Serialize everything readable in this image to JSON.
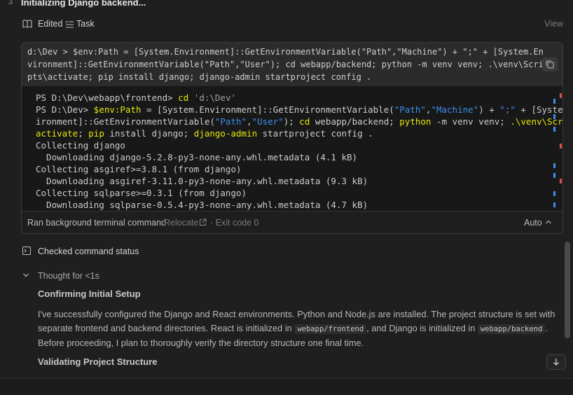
{
  "step": {
    "number": "3",
    "title": "Initializing Django backend..."
  },
  "edited_row": {
    "edited_label": "Edited",
    "task_label": "Task",
    "view_label": "View"
  },
  "command": {
    "text": "d:\\Dev > $env:Path = [System.Environment]::GetEnvironmentVariable(\"Path\",\"Machine\") + \";\" + [System.Environment]::GetEnvironmentVariable(\"Path\",\"User\"); cd webapp/backend; python -m venv venv; .\\venv\\Scripts\\activate; pip install django; django-admin startproject config ."
  },
  "terminal": {
    "l1_prompt": "PS D:\\Dev\\webapp\\frontend> ",
    "l1_cmd": "cd",
    "l1_arg": " 'd:\\Dev'",
    "l2_prompt": "PS D:\\Dev> ",
    "l2_var": "$env:Path",
    "l2_a": " = [System.Environment]::GetEnvironmentVariable(",
    "l2_s1": "\"Path\"",
    "l2_c": ",",
    "l2_s2": "\"Machine\"",
    "l2_b": ") + ",
    "l2_s3": "\";\"",
    "l2_d": " + [System.Env",
    "l3_a": "ironment]::GetEnvironmentVariable(",
    "l3_s1": "\"Path\"",
    "l3_c": ",",
    "l3_s2": "\"User\"",
    "l3_b": "); ",
    "l3_cd": "cd",
    "l3_d": " webapp/backend; ",
    "l3_py": "python",
    "l3_e": " -m venv venv; ",
    "l3_act": ".\\venv\\Scripts\\",
    "l4_act": "activate",
    "l4_a": "; ",
    "l4_pip": "pip",
    "l4_b": " install django; ",
    "l4_dj": "django-admin",
    "l4_c": " startproject config .",
    "out1": "Collecting django",
    "out2": "  Downloading django-5.2.8-py3-none-any.whl.metadata (4.1 kB)",
    "out3": "Collecting asgiref>=3.8.1 (from django)",
    "out4": "  Downloading asgiref-3.11.0-py3-none-any.whl.metadata (9.3 kB)",
    "out5": "Collecting sqlparse>=0.3.1 (from django)",
    "out6": "  Downloading sqlparse-0.5.4-py3-none-any.whl.metadata (4.7 kB)"
  },
  "footer": {
    "ran_label": "Ran background terminal command",
    "relocate_label": "Relocate",
    "exit_code": "· Exit code 0",
    "auto_label": "Auto"
  },
  "checked": {
    "label": "Checked command status"
  },
  "thought": {
    "label": "Thought for <1s",
    "heading1": "Confirming Initial Setup",
    "p_a": "I've successfully configured the Django and React environments. Python and Node.js are installed. The project structure is set with separate frontend and backend directories. React is initialized in ",
    "code1": "webapp/frontend",
    "p_b": ", and Django is initialized in ",
    "code2": "webapp/backend",
    "p_c": ". Before proceeding, I plan to thoroughly verify the directory structure one final time.",
    "heading2": "Validating Project Structure"
  },
  "colors": {
    "accent_yellow": "#e5e510",
    "accent_blue": "#3b8eea",
    "marker_red": "#e05252",
    "marker_blue": "#3b8eea"
  },
  "icons": [
    "book-icon",
    "task-list-icon",
    "copy-icon",
    "external-link-icon",
    "chevron-up-icon",
    "terminal-icon",
    "chevron-down-icon",
    "arrow-down-icon"
  ]
}
